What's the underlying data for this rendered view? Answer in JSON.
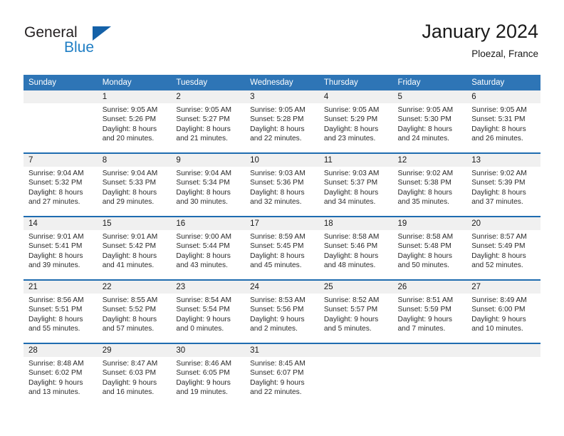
{
  "brand": {
    "name_part1": "General",
    "name_part2": "Blue",
    "triangle_icon": "triangle-icon",
    "accent_blue": "#1f7ec4",
    "dark_blue": "#1461a8"
  },
  "header": {
    "title": "January 2024",
    "location": "Ploezal, France"
  },
  "colors": {
    "header_row": "#2e75b6",
    "week_separator": "#1f6cb0",
    "daynum_band": "#f0f0f0",
    "text": "#1a1a1a"
  },
  "weekday_headers": [
    "Sunday",
    "Monday",
    "Tuesday",
    "Wednesday",
    "Thursday",
    "Friday",
    "Saturday"
  ],
  "weeks": [
    [
      {
        "day": "",
        "lines": []
      },
      {
        "day": "1",
        "lines": [
          "Sunrise: 9:05 AM",
          "Sunset: 5:26 PM",
          "Daylight: 8 hours",
          "and 20 minutes."
        ]
      },
      {
        "day": "2",
        "lines": [
          "Sunrise: 9:05 AM",
          "Sunset: 5:27 PM",
          "Daylight: 8 hours",
          "and 21 minutes."
        ]
      },
      {
        "day": "3",
        "lines": [
          "Sunrise: 9:05 AM",
          "Sunset: 5:28 PM",
          "Daylight: 8 hours",
          "and 22 minutes."
        ]
      },
      {
        "day": "4",
        "lines": [
          "Sunrise: 9:05 AM",
          "Sunset: 5:29 PM",
          "Daylight: 8 hours",
          "and 23 minutes."
        ]
      },
      {
        "day": "5",
        "lines": [
          "Sunrise: 9:05 AM",
          "Sunset: 5:30 PM",
          "Daylight: 8 hours",
          "and 24 minutes."
        ]
      },
      {
        "day": "6",
        "lines": [
          "Sunrise: 9:05 AM",
          "Sunset: 5:31 PM",
          "Daylight: 8 hours",
          "and 26 minutes."
        ]
      }
    ],
    [
      {
        "day": "7",
        "lines": [
          "Sunrise: 9:04 AM",
          "Sunset: 5:32 PM",
          "Daylight: 8 hours",
          "and 27 minutes."
        ]
      },
      {
        "day": "8",
        "lines": [
          "Sunrise: 9:04 AM",
          "Sunset: 5:33 PM",
          "Daylight: 8 hours",
          "and 29 minutes."
        ]
      },
      {
        "day": "9",
        "lines": [
          "Sunrise: 9:04 AM",
          "Sunset: 5:34 PM",
          "Daylight: 8 hours",
          "and 30 minutes."
        ]
      },
      {
        "day": "10",
        "lines": [
          "Sunrise: 9:03 AM",
          "Sunset: 5:36 PM",
          "Daylight: 8 hours",
          "and 32 minutes."
        ]
      },
      {
        "day": "11",
        "lines": [
          "Sunrise: 9:03 AM",
          "Sunset: 5:37 PM",
          "Daylight: 8 hours",
          "and 34 minutes."
        ]
      },
      {
        "day": "12",
        "lines": [
          "Sunrise: 9:02 AM",
          "Sunset: 5:38 PM",
          "Daylight: 8 hours",
          "and 35 minutes."
        ]
      },
      {
        "day": "13",
        "lines": [
          "Sunrise: 9:02 AM",
          "Sunset: 5:39 PM",
          "Daylight: 8 hours",
          "and 37 minutes."
        ]
      }
    ],
    [
      {
        "day": "14",
        "lines": [
          "Sunrise: 9:01 AM",
          "Sunset: 5:41 PM",
          "Daylight: 8 hours",
          "and 39 minutes."
        ]
      },
      {
        "day": "15",
        "lines": [
          "Sunrise: 9:01 AM",
          "Sunset: 5:42 PM",
          "Daylight: 8 hours",
          "and 41 minutes."
        ]
      },
      {
        "day": "16",
        "lines": [
          "Sunrise: 9:00 AM",
          "Sunset: 5:44 PM",
          "Daylight: 8 hours",
          "and 43 minutes."
        ]
      },
      {
        "day": "17",
        "lines": [
          "Sunrise: 8:59 AM",
          "Sunset: 5:45 PM",
          "Daylight: 8 hours",
          "and 45 minutes."
        ]
      },
      {
        "day": "18",
        "lines": [
          "Sunrise: 8:58 AM",
          "Sunset: 5:46 PM",
          "Daylight: 8 hours",
          "and 48 minutes."
        ]
      },
      {
        "day": "19",
        "lines": [
          "Sunrise: 8:58 AM",
          "Sunset: 5:48 PM",
          "Daylight: 8 hours",
          "and 50 minutes."
        ]
      },
      {
        "day": "20",
        "lines": [
          "Sunrise: 8:57 AM",
          "Sunset: 5:49 PM",
          "Daylight: 8 hours",
          "and 52 minutes."
        ]
      }
    ],
    [
      {
        "day": "21",
        "lines": [
          "Sunrise: 8:56 AM",
          "Sunset: 5:51 PM",
          "Daylight: 8 hours",
          "and 55 minutes."
        ]
      },
      {
        "day": "22",
        "lines": [
          "Sunrise: 8:55 AM",
          "Sunset: 5:52 PM",
          "Daylight: 8 hours",
          "and 57 minutes."
        ]
      },
      {
        "day": "23",
        "lines": [
          "Sunrise: 8:54 AM",
          "Sunset: 5:54 PM",
          "Daylight: 9 hours",
          "and 0 minutes."
        ]
      },
      {
        "day": "24",
        "lines": [
          "Sunrise: 8:53 AM",
          "Sunset: 5:56 PM",
          "Daylight: 9 hours",
          "and 2 minutes."
        ]
      },
      {
        "day": "25",
        "lines": [
          "Sunrise: 8:52 AM",
          "Sunset: 5:57 PM",
          "Daylight: 9 hours",
          "and 5 minutes."
        ]
      },
      {
        "day": "26",
        "lines": [
          "Sunrise: 8:51 AM",
          "Sunset: 5:59 PM",
          "Daylight: 9 hours",
          "and 7 minutes."
        ]
      },
      {
        "day": "27",
        "lines": [
          "Sunrise: 8:49 AM",
          "Sunset: 6:00 PM",
          "Daylight: 9 hours",
          "and 10 minutes."
        ]
      }
    ],
    [
      {
        "day": "28",
        "lines": [
          "Sunrise: 8:48 AM",
          "Sunset: 6:02 PM",
          "Daylight: 9 hours",
          "and 13 minutes."
        ]
      },
      {
        "day": "29",
        "lines": [
          "Sunrise: 8:47 AM",
          "Sunset: 6:03 PM",
          "Daylight: 9 hours",
          "and 16 minutes."
        ]
      },
      {
        "day": "30",
        "lines": [
          "Sunrise: 8:46 AM",
          "Sunset: 6:05 PM",
          "Daylight: 9 hours",
          "and 19 minutes."
        ]
      },
      {
        "day": "31",
        "lines": [
          "Sunrise: 8:45 AM",
          "Sunset: 6:07 PM",
          "Daylight: 9 hours",
          "and 22 minutes."
        ]
      },
      {
        "day": "",
        "lines": []
      },
      {
        "day": "",
        "lines": []
      },
      {
        "day": "",
        "lines": []
      }
    ]
  ]
}
